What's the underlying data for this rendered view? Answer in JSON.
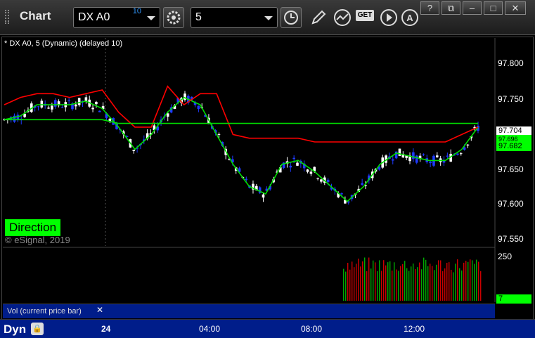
{
  "window": {
    "title": "Chart",
    "symbol": "DX A0",
    "symbol_badge": "10",
    "interval": "5",
    "buttons": {
      "help": "?",
      "restore": "⧉",
      "minimize": "–",
      "maximize": "□",
      "close": "✕"
    }
  },
  "toolbar_icons": [
    "settings-icon",
    "clock-icon",
    "pencil-icon",
    "line-chart-icon",
    "get-icon",
    "play-icon",
    "alert-icon"
  ],
  "toolbar_get_text": "GET",
  "chart": {
    "study_label": "* DX A0, 5 (Dynamic) (delayed 10)",
    "direction_label": "Direction",
    "copyright": "© eSignal, 2019",
    "price_axis": [
      "97.800",
      "97.750",
      "97.700",
      "97.650",
      "97.600",
      "97.550"
    ],
    "last_price": "97.704",
    "green_price": "97.682",
    "hidden_price": "97.696",
    "volume_axis": "250",
    "volume_value": "7",
    "volume_panel_label": "Vol (current price bar)",
    "volume_panel_close": "✕",
    "time_axis": [
      "24",
      "04:00",
      "08:00",
      "12:00"
    ],
    "bottom_label": "Dyn",
    "lock_icon": "lock-icon"
  },
  "colors": {
    "up_candle": "#ffffff",
    "down_candle": "#1f3bff",
    "red_line": "#ff0000",
    "green_line": "#00e000",
    "panel_blue": "#001d8a"
  },
  "chart_data": {
    "type": "candlestick",
    "ylim": [
      97.54,
      97.82
    ],
    "series": [
      {
        "name": "fast-ma",
        "values": [
          97.71,
          97.715,
          97.73,
          97.73,
          97.73,
          97.735,
          97.725,
          97.7,
          97.67,
          97.69,
          97.72,
          97.74,
          97.73,
          97.69,
          97.65,
          97.62,
          97.61,
          97.65,
          97.655,
          97.64,
          97.62,
          97.6,
          97.62,
          97.65,
          97.665,
          97.66,
          97.655,
          97.655,
          97.67,
          97.7
        ]
      },
      {
        "name": "slow-ma",
        "values": [
          97.73,
          97.74,
          97.745,
          97.745,
          97.74,
          97.745,
          97.75,
          97.72,
          97.7,
          97.7,
          97.755,
          97.73,
          97.745,
          97.745,
          97.69,
          97.685,
          97.685,
          97.685,
          97.685,
          97.68,
          97.68,
          97.68,
          97.68,
          97.68,
          97.68,
          97.68,
          97.68,
          97.68,
          97.69,
          97.7
        ]
      },
      {
        "name": "flat-green",
        "values": [
          97.71,
          97.71,
          97.71,
          97.71,
          97.71,
          97.71,
          97.71,
          97.705,
          97.705,
          97.705,
          97.705,
          97.705,
          97.705,
          97.705,
          97.705,
          97.705,
          97.705,
          97.705,
          97.705,
          97.705,
          97.705,
          97.705,
          97.705,
          97.705,
          97.705,
          97.705,
          97.705,
          97.705,
          97.705,
          97.705
        ]
      }
    ]
  }
}
